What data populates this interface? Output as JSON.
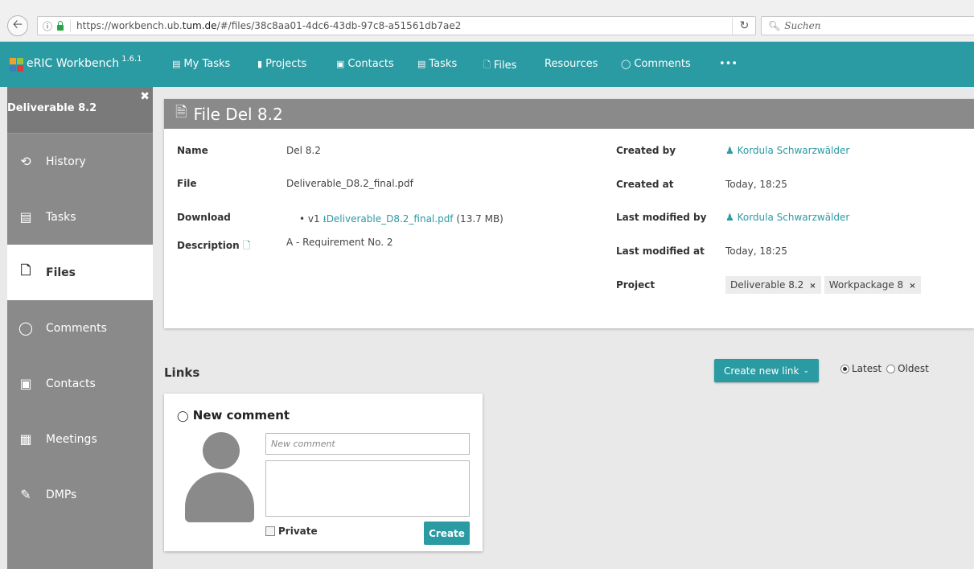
{
  "browser": {
    "url_prefix": "https://workbench.ub.",
    "url_domain": "tum.de",
    "url_suffix": "/#/files/38c8aa01-4dc6-43db-97c8-a51561db7ae2",
    "search_placeholder": "Suchen"
  },
  "nav": {
    "brand": "eRIC Workbench",
    "version": "1.6.1",
    "items": [
      {
        "label": "My Tasks",
        "icon": "tasks-icon"
      },
      {
        "label": "Projects",
        "icon": "folder-icon"
      },
      {
        "label": "Contacts",
        "icon": "contact-icon"
      },
      {
        "label": "Tasks",
        "icon": "tasks-icon"
      },
      {
        "label": "Files",
        "icon": "file-icon"
      },
      {
        "label": "Resources",
        "icon": ""
      },
      {
        "label": "Comments",
        "icon": "comment-icon"
      },
      {
        "label": "•••",
        "icon": ""
      }
    ],
    "accent": "#2a9aa3"
  },
  "sidebar": {
    "title": "Deliverable 8.2",
    "items": [
      {
        "label": "History",
        "icon": "history-icon"
      },
      {
        "label": "Tasks",
        "icon": "tasks-icon"
      },
      {
        "label": "Files",
        "icon": "file-icon",
        "active": true
      },
      {
        "label": "Comments",
        "icon": "comment-icon"
      },
      {
        "label": "Contacts",
        "icon": "contact-icon"
      },
      {
        "label": "Meetings",
        "icon": "calendar-icon"
      },
      {
        "label": "DMPs",
        "icon": "edit-icon"
      }
    ]
  },
  "file": {
    "header": "File Del 8.2",
    "name_label": "Name",
    "name_value": "Del 8.2",
    "file_label": "File",
    "file_value": "Deliverable_D8.2_final.pdf",
    "download_label": "Download",
    "download_version": "v1",
    "download_link": "Deliverable_D8.2_final.pdf",
    "download_size": "(13.7 MB)",
    "description_label": "Description",
    "description_value": "A - Requirement No. 2",
    "created_by_label": "Created by",
    "created_by_value": "Kordula Schwarzwälder",
    "created_at_label": "Created at",
    "created_at_value": "Today, 18:25",
    "last_modified_by_label": "Last modified by",
    "last_modified_by_value": "Kordula Schwarzwälder",
    "last_modified_at_label": "Last modified at",
    "last_modified_at_value": "Today, 18:25",
    "project_label": "Project",
    "project_tags": [
      "Deliverable 8.2",
      "Workpackage 8"
    ]
  },
  "links": {
    "title": "Links",
    "create_button": "Create new link",
    "sort_latest": "Latest",
    "sort_oldest": "Oldest"
  },
  "comment": {
    "title": "New comment",
    "title_placeholder": "New comment",
    "private_label": "Private",
    "create_button": "Create"
  }
}
